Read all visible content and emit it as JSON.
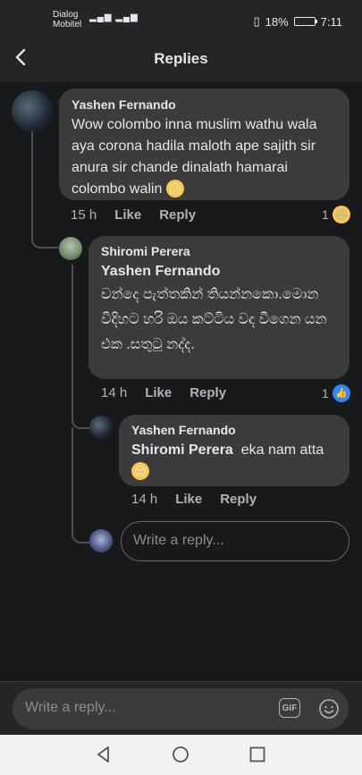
{
  "status": {
    "carrier_line1": "Dialog",
    "carrier_line2": "Mobitel",
    "battery": "18%",
    "time": "7:11"
  },
  "header": {
    "title": "Replies"
  },
  "comments": [
    {
      "author": "Yashen Fernando",
      "text": "Wow colombo inna muslim wathu wala aya corona hadila maloth ape sajith sir anura sir chande dinalath hamarai colombo walin",
      "text_emoji": "😕",
      "time": "15 h",
      "like": "Like",
      "reply": "Reply",
      "reaction_count": "1",
      "reaction_emoji": "😆"
    },
    {
      "author": "Shiromi Perera",
      "mention": "Yashen Fernando",
      "text": "චන්දෙ පැත්තකින් තියන්නකො.මොන විදිහට හරි ඔය කට්ටිය වද වීගෙන යන එක .සතුටු නද්ද.",
      "time": "14 h",
      "like": "Like",
      "reply": "Reply",
      "reaction_count": "1",
      "reaction_emoji": "👍"
    },
    {
      "author": "Yashen Fernando",
      "mention": "Shiromi Perera",
      "text": "eka nam atta",
      "text_emoji": "😌",
      "time": "14 h",
      "like": "Like",
      "reply": "Reply"
    }
  ],
  "inline_reply": {
    "placeholder": "Write a reply..."
  },
  "composer": {
    "placeholder": "Write a reply...",
    "gif_label": "GIF"
  }
}
